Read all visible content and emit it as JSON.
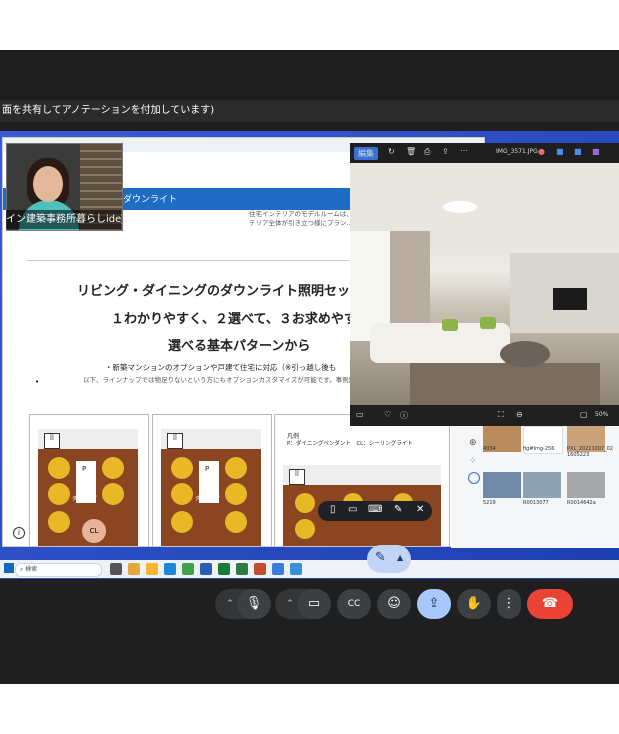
{
  "share_banner": {
    "text": "面を共有してアノテーションを付加しています)"
  },
  "document": {
    "header_label": "ダウンライト",
    "intro_text": "住宅インテリアのモデルルームは、お… から照明器具の配置やセットのサ… ンテリア全体が引き立つ様にプラン…",
    "heading_line1": "リビング・ダイニングのダウンライト照明セッ",
    "heading_line2": "１わかりやすく、２選べて、３お求めやす",
    "heading_line3": "選べる基本パターンから",
    "bullet1": "・新築マンションのオプションや戸建て住宅に対応（※引っ越し後も",
    "bullet2": "以下、ラインナップでは物足りないという方にもオプションカスタマイズが可能です。事例集も参",
    "plan_label_p": "P",
    "plan_label_dining": "ダイニング",
    "plan_label_cl": "CL",
    "legend_title": "凡例",
    "legend_text": "P：ダイニングペンダント　CL：シーリングライト"
  },
  "webcam": {
    "name": "イン建築事務所暮らしide"
  },
  "viewer": {
    "edit_label": "編集",
    "filename": "IMG_3571.JPG",
    "zoom": "50%"
  },
  "explorer": {
    "items": [
      {
        "label": "4034"
      },
      {
        "label": "fig#Img-256"
      },
      {
        "label": "PXL_20211007_02 1605223"
      },
      {
        "label": "5219"
      },
      {
        "label": "R0013077"
      },
      {
        "label": "R0014642a"
      }
    ]
  },
  "taskbar": {
    "search_placeholder": "検索"
  },
  "meet_controls": {
    "mic": "mic-icon",
    "camera": "camera-icon",
    "captions_label": "CC",
    "present": "present-icon",
    "raise_hand": "hand-icon",
    "more": "more-icon",
    "leave": "leave-call-icon"
  },
  "colors": {
    "doc_header_blue": "#1e6cc4",
    "present_active": "#a8c7fa",
    "leave_red": "#ea4335",
    "meet_bg": "#1f1f1f",
    "desktop_blue": "#2b4fc8"
  }
}
